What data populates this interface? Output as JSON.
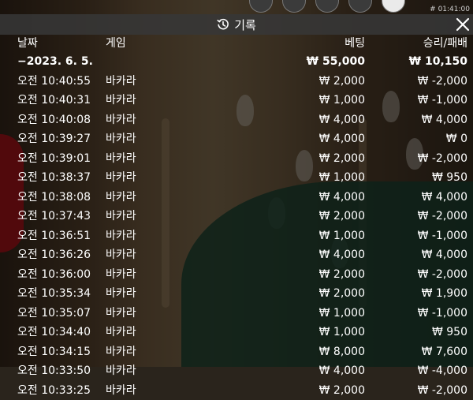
{
  "window": {
    "timestamp": "# 01:41:00",
    "title": "기록",
    "title_icon": "history-icon",
    "close_icon": "close-icon"
  },
  "columns": {
    "date": "날짜",
    "game": "게임",
    "bet": "베팅",
    "win_loss": "승리/패배"
  },
  "summary": {
    "date": "−2023. 6. 5.",
    "bet": "₩ 55,000",
    "win_loss": "₩ 10,150"
  },
  "rows": [
    {
      "time": "오전 10:40:55",
      "game": "바카라",
      "bet": "₩ 2,000",
      "result": "₩ -2,000"
    },
    {
      "time": "오전 10:40:31",
      "game": "바카라",
      "bet": "₩ 1,000",
      "result": "₩ -1,000"
    },
    {
      "time": "오전 10:40:08",
      "game": "바카라",
      "bet": "₩ 4,000",
      "result": "₩ 4,000"
    },
    {
      "time": "오전 10:39:27",
      "game": "바카라",
      "bet": "₩ 4,000",
      "result": "₩ 0"
    },
    {
      "time": "오전 10:39:01",
      "game": "바카라",
      "bet": "₩ 2,000",
      "result": "₩ -2,000"
    },
    {
      "time": "오전 10:38:37",
      "game": "바카라",
      "bet": "₩ 1,000",
      "result": "₩ 950"
    },
    {
      "time": "오전 10:38:08",
      "game": "바카라",
      "bet": "₩ 4,000",
      "result": "₩ 4,000"
    },
    {
      "time": "오전 10:37:43",
      "game": "바카라",
      "bet": "₩ 2,000",
      "result": "₩ -2,000"
    },
    {
      "time": "오전 10:36:51",
      "game": "바카라",
      "bet": "₩ 1,000",
      "result": "₩ -1,000"
    },
    {
      "time": "오전 10:36:26",
      "game": "바카라",
      "bet": "₩ 4,000",
      "result": "₩ 4,000"
    },
    {
      "time": "오전 10:36:00",
      "game": "바카라",
      "bet": "₩ 2,000",
      "result": "₩ -2,000"
    },
    {
      "time": "오전 10:35:34",
      "game": "바카라",
      "bet": "₩ 2,000",
      "result": "₩ 1,900"
    },
    {
      "time": "오전 10:35:07",
      "game": "바카라",
      "bet": "₩ 1,000",
      "result": "₩ -1,000"
    },
    {
      "time": "오전 10:34:40",
      "game": "바카라",
      "bet": "₩ 1,000",
      "result": "₩ 950"
    },
    {
      "time": "오전 10:34:15",
      "game": "바카라",
      "bet": "₩ 8,000",
      "result": "₩ 7,600"
    },
    {
      "time": "오전 10:33:50",
      "game": "바카라",
      "bet": "₩ 4,000",
      "result": "₩ -4,000"
    },
    {
      "time": "오전 10:33:25",
      "game": "바카라",
      "bet": "₩ 2,000",
      "result": "₩ -2,000"
    }
  ]
}
